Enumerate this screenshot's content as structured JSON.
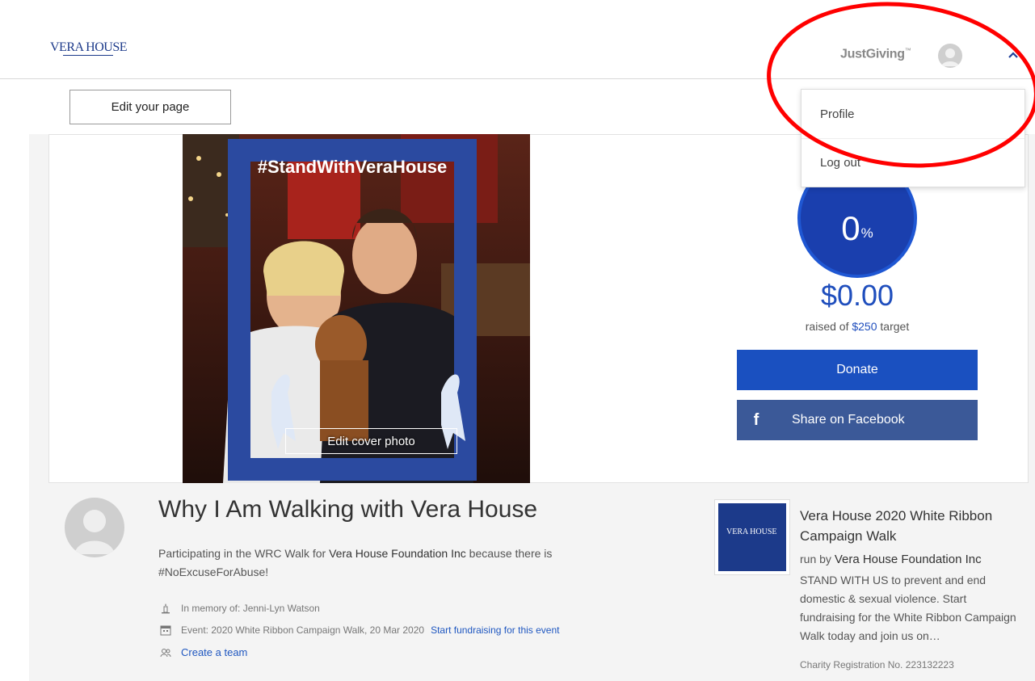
{
  "header": {
    "logo_text": "VERA HOUSE",
    "brand": "JustGiving",
    "brand_mark": "™"
  },
  "toolbar": {
    "edit_page_label": "Edit your page"
  },
  "user_menu": {
    "items": [
      {
        "label": "Profile"
      },
      {
        "label": "Log out"
      }
    ]
  },
  "cover": {
    "edit_label": "Edit cover photo",
    "frame_text": "#StandWithVeraHouse"
  },
  "progress": {
    "percent": "0",
    "percent_sign": "%",
    "raised": "$0.00",
    "target_prefix": "raised of ",
    "target_amount": "$250",
    "target_suffix": " target"
  },
  "actions": {
    "donate_label": "Donate",
    "share_label": "Share on Facebook"
  },
  "fundraiser": {
    "title": "Why I Am Walking with Vera House",
    "desc_prefix": "Participating in the WRC Walk for ",
    "charity": "Vera House Foundation Inc",
    "desc_suffix": " because there is #NoExcuseForAbuse!",
    "memory": "In memory of: Jenni-Lyn Watson",
    "event": "Event: 2020 White Ribbon Campaign Walk, 20 Mar 2020",
    "start_fundraising": "Start fundraising for this event",
    "create_team": "Create a team"
  },
  "event_card": {
    "thumb_text": "VERA HOUSE",
    "title": "Vera House 2020 White Ribbon Campaign Walk",
    "run_by_prefix": "run by ",
    "org": "Vera House Foundation Inc",
    "description": "STAND WITH US to prevent and end domestic & sexual violence. Start fundraising for the White Ribbon Campaign Walk today and join us on…",
    "registration": "Charity Registration No. 223132223"
  },
  "colors": {
    "primary": "#1a50c0",
    "facebook": "#3b5998",
    "circle": "#1a3fae",
    "annotation": "#ff0000"
  }
}
